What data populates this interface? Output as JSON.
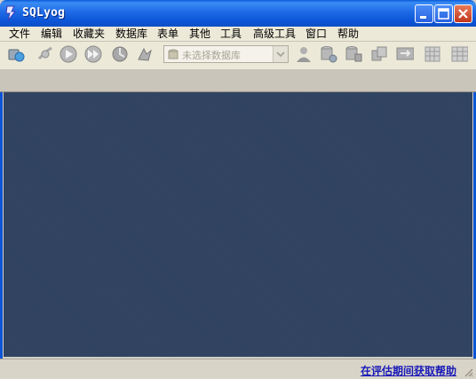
{
  "window": {
    "title": "SQLyog"
  },
  "menu": [
    "文件",
    "编辑",
    "收藏夹",
    "数据库",
    "表单",
    "其他",
    "工具",
    "高级工具",
    "窗口",
    "帮助"
  ],
  "toolbar": {
    "icons": [
      "new-connection-icon",
      "disconnect-icon",
      "execute-query-icon",
      "execute-all-icon",
      "refresh-icon",
      "stop-icon",
      "user-manager-icon",
      "backup-icon",
      "restore-icon",
      "copy-database-icon",
      "sync-icon",
      "table-grid-icon",
      "table-structure-icon"
    ],
    "database_select": {
      "placeholder": "未选择数据库"
    }
  },
  "status": {
    "link": "在评估期间获取帮助"
  }
}
